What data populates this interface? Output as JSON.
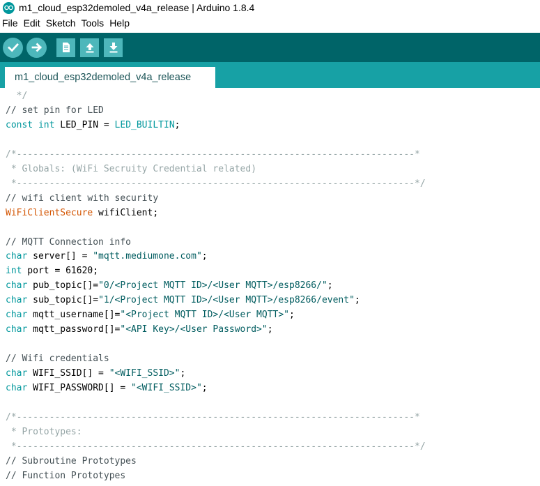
{
  "window": {
    "title": "m1_cloud_esp32demoled_v4a_release | Arduino 1.8.4"
  },
  "menu": {
    "items": [
      "File",
      "Edit",
      "Sketch",
      "Tools",
      "Help"
    ]
  },
  "toolbar": {
    "buttons": [
      {
        "name": "verify",
        "icon": "checkmark-icon"
      },
      {
        "name": "upload",
        "icon": "arrow-right-icon"
      },
      {
        "name": "new",
        "icon": "new-document-icon"
      },
      {
        "name": "open",
        "icon": "arrow-up-icon"
      },
      {
        "name": "save",
        "icon": "arrow-down-icon"
      }
    ],
    "colors": {
      "bar": "#006468",
      "button": "#4db7bb"
    }
  },
  "tabs": [
    {
      "label": "m1_cloud_esp32demoled_v4a_release",
      "active": true
    }
  ],
  "editor": {
    "lines": [
      [
        [
          "block",
          "  */"
        ]
      ],
      [
        [
          "comment",
          "// set pin for LED"
        ]
      ],
      [
        [
          "const",
          "const"
        ],
        [
          "plain",
          " "
        ],
        [
          "type",
          "int"
        ],
        [
          "plain",
          " LED_PIN = "
        ],
        [
          "const",
          "LED_BUILTIN"
        ],
        [
          "plain",
          ";"
        ]
      ],
      [
        [
          "plain",
          ""
        ]
      ],
      [
        [
          "block",
          "/*-------------------------------------------------------------------------*"
        ]
      ],
      [
        [
          "block",
          " * Globals: (WiFi Secruity Credential related)"
        ]
      ],
      [
        [
          "block",
          " *-------------------------------------------------------------------------*/"
        ]
      ],
      [
        [
          "comment",
          "// wifi client with security"
        ]
      ],
      [
        [
          "class",
          "WiFiClientSecure"
        ],
        [
          "plain",
          " wifiClient;"
        ]
      ],
      [
        [
          "plain",
          ""
        ]
      ],
      [
        [
          "comment",
          "// MQTT Connection info"
        ]
      ],
      [
        [
          "type",
          "char"
        ],
        [
          "plain",
          " server[] = "
        ],
        [
          "str",
          "\"mqtt.mediumone.com\""
        ],
        [
          "plain",
          ";"
        ]
      ],
      [
        [
          "type",
          "int"
        ],
        [
          "plain",
          " port = 61620;"
        ]
      ],
      [
        [
          "type",
          "char"
        ],
        [
          "plain",
          " pub_topic[]="
        ],
        [
          "str",
          "\"0/<Project MQTT ID>/<User MQTT>/esp8266/\""
        ],
        [
          "plain",
          ";"
        ]
      ],
      [
        [
          "type",
          "char"
        ],
        [
          "plain",
          " sub_topic[]="
        ],
        [
          "str",
          "\"1/<Project MQTT ID>/<User MQTT>/esp8266/event\""
        ],
        [
          "plain",
          ";"
        ]
      ],
      [
        [
          "type",
          "char"
        ],
        [
          "plain",
          " mqtt_username[]="
        ],
        [
          "str",
          "\"<Project MQTT ID>/<User MQTT>\""
        ],
        [
          "plain",
          ";"
        ]
      ],
      [
        [
          "type",
          "char"
        ],
        [
          "plain",
          " mqtt_password[]="
        ],
        [
          "str",
          "\"<API Key>/<User Password>\""
        ],
        [
          "plain",
          ";"
        ]
      ],
      [
        [
          "plain",
          ""
        ]
      ],
      [
        [
          "comment",
          "// Wifi credentials"
        ]
      ],
      [
        [
          "type",
          "char"
        ],
        [
          "plain",
          " WIFI_SSID[] = "
        ],
        [
          "str",
          "\"<WIFI_SSID>\""
        ],
        [
          "plain",
          ";"
        ]
      ],
      [
        [
          "type",
          "char"
        ],
        [
          "plain",
          " WIFI_PASSWORD[] = "
        ],
        [
          "str",
          "\"<WIFI_SSID>\""
        ],
        [
          "plain",
          ";"
        ]
      ],
      [
        [
          "plain",
          ""
        ]
      ],
      [
        [
          "block",
          "/*-------------------------------------------------------------------------*"
        ]
      ],
      [
        [
          "block",
          " * Prototypes:"
        ]
      ],
      [
        [
          "block",
          " *-------------------------------------------------------------------------*/"
        ]
      ],
      [
        [
          "comment",
          "// Subroutine Prototypes"
        ]
      ],
      [
        [
          "comment",
          "// Function Prototypes"
        ]
      ]
    ],
    "colors": {
      "comment": "#434f54",
      "block": "#95a5a6",
      "type": "#00979c",
      "const": "#00979c",
      "class": "#d35400",
      "str": "#005c5f",
      "plain": "#000000"
    }
  }
}
